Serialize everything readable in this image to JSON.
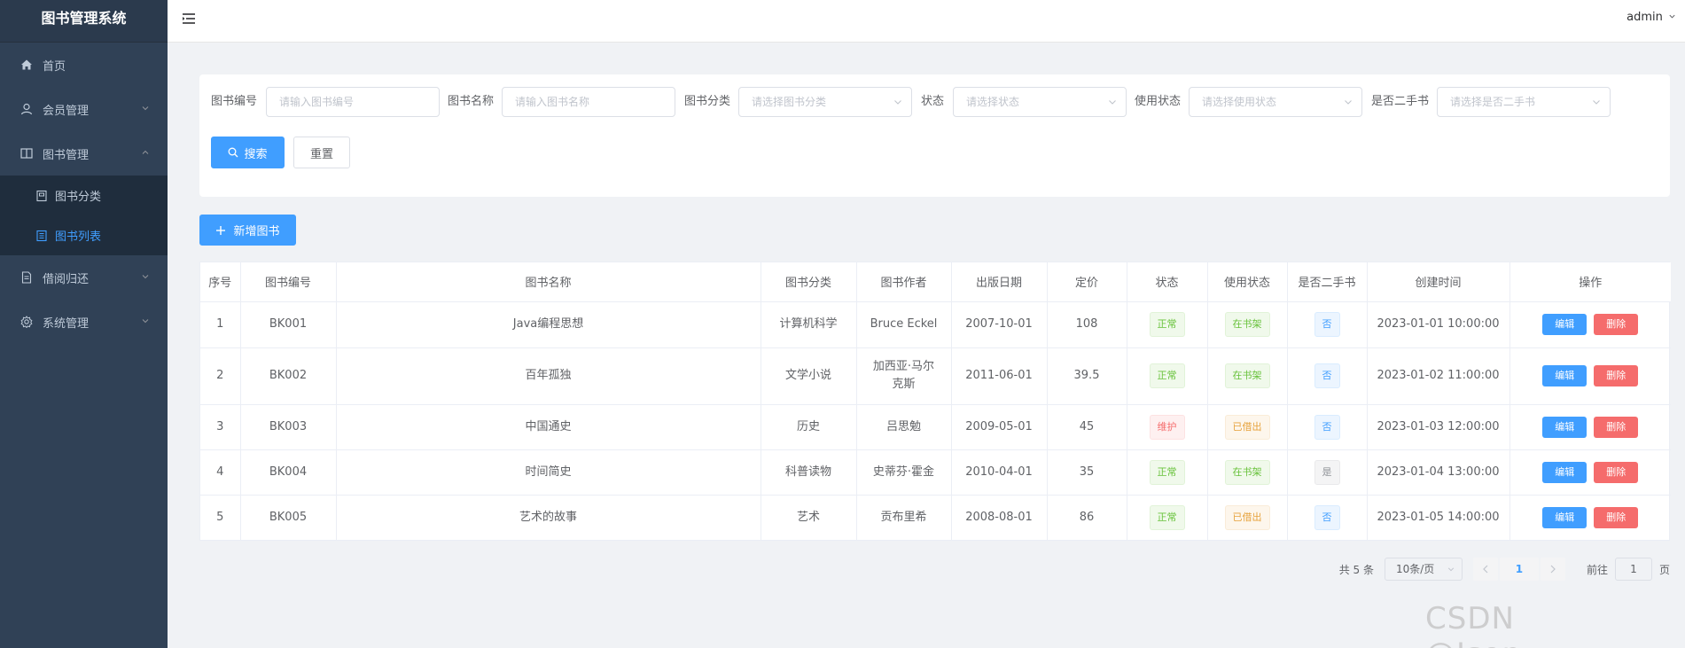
{
  "app": {
    "title": "图书管理系统"
  },
  "topbar": {
    "user": "admin"
  },
  "sidebar": {
    "items": [
      {
        "label": "首页",
        "icon": "home-icon"
      },
      {
        "label": "会员管理",
        "icon": "user-icon"
      },
      {
        "label": "图书管理",
        "icon": "book-icon"
      },
      {
        "label": "借阅归还",
        "icon": "document-icon"
      },
      {
        "label": "系统管理",
        "icon": "gear-icon"
      }
    ],
    "book_sub": [
      {
        "label": "图书分类",
        "icon": "category-icon"
      },
      {
        "label": "图书列表",
        "icon": "list-icon"
      }
    ]
  },
  "search": {
    "fields": [
      {
        "label": "图书编号",
        "placeholder": "请输入图书编号"
      },
      {
        "label": "图书名称",
        "placeholder": "请输入图书名称"
      },
      {
        "label": "图书分类",
        "placeholder": "请选择图书分类"
      },
      {
        "label": "状态",
        "placeholder": "请选择状态"
      },
      {
        "label": "使用状态",
        "placeholder": "请选择使用状态"
      },
      {
        "label": "是否二手书",
        "placeholder": "请选择是否二手书"
      }
    ],
    "search_label": "搜索",
    "reset_label": "重置"
  },
  "toolbar": {
    "add_label": "新增图书"
  },
  "table": {
    "headers": [
      "序号",
      "图书编号",
      "图书名称",
      "图书分类",
      "图书作者",
      "出版日期",
      "定价",
      "状态",
      "使用状态",
      "是否二手书",
      "创建时间",
      "操作"
    ],
    "edit_label": "编辑",
    "delete_label": "删除",
    "rows": [
      {
        "index": "1",
        "code": "BK001",
        "name": "Java编程思想",
        "category": "计算机科学",
        "author": "Bruce Eckel",
        "date": "2007-10-01",
        "price": "108",
        "status": "正常",
        "use_status": "在书架",
        "second_hand": "否",
        "created": "2023-01-01 10:00:00"
      },
      {
        "index": "2",
        "code": "BK002",
        "name": "百年孤独",
        "category": "文学小说",
        "author": "加西亚·马尔克斯",
        "date": "2011-06-01",
        "price": "39.5",
        "status": "正常",
        "use_status": "在书架",
        "second_hand": "否",
        "created": "2023-01-02 11:00:00"
      },
      {
        "index": "3",
        "code": "BK003",
        "name": "中国通史",
        "category": "历史",
        "author": "吕思勉",
        "date": "2009-05-01",
        "price": "45",
        "status": "维护",
        "use_status": "已借出",
        "second_hand": "否",
        "created": "2023-01-03 12:00:00"
      },
      {
        "index": "4",
        "code": "BK004",
        "name": "时间简史",
        "category": "科普读物",
        "author": "史蒂芬·霍金",
        "date": "2010-04-01",
        "price": "35",
        "status": "正常",
        "use_status": "在书架",
        "second_hand": "是",
        "created": "2023-01-04 13:00:00"
      },
      {
        "index": "5",
        "code": "BK005",
        "name": "艺术的故事",
        "category": "艺术",
        "author": "贡布里希",
        "date": "2008-08-01",
        "price": "86",
        "status": "正常",
        "use_status": "已借出",
        "second_hand": "否",
        "created": "2023-01-05 14:00:00"
      }
    ]
  },
  "pagination": {
    "total_text": "共 5 条",
    "page_size": "10条/页",
    "current": "1",
    "goto_prefix": "前往",
    "goto_value": "1",
    "goto_suffix": "页"
  },
  "watermark": "CSDN @Json_____",
  "colors": {
    "primary": "#409eff",
    "danger": "#f56c6c",
    "sidebar": "#304156"
  }
}
